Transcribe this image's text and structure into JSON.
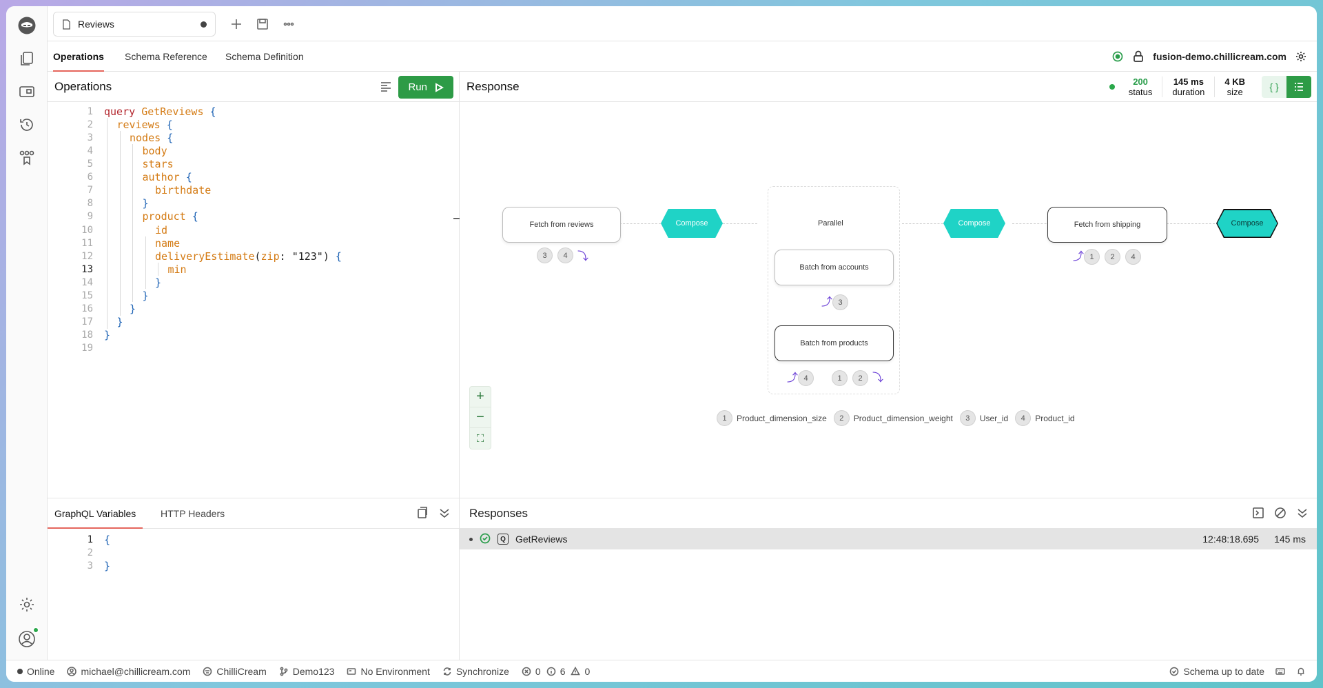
{
  "tab": {
    "title": "Reviews"
  },
  "subnav": {
    "items": [
      "Operations",
      "Schema Reference",
      "Schema Definition"
    ],
    "endpoint": "fusion-demo.chillicream.com"
  },
  "operations": {
    "title": "Operations",
    "run_label": "Run",
    "lines": [
      {
        "n": "1",
        "indent": 0,
        "parts": [
          [
            "kw",
            "query "
          ],
          [
            "nm",
            "GetReviews "
          ],
          [
            "br",
            "{"
          ]
        ]
      },
      {
        "n": "2",
        "indent": 1,
        "parts": [
          [
            "fld",
            "reviews "
          ],
          [
            "br",
            "{"
          ]
        ]
      },
      {
        "n": "3",
        "indent": 2,
        "parts": [
          [
            "fld",
            "nodes "
          ],
          [
            "br",
            "{"
          ]
        ]
      },
      {
        "n": "4",
        "indent": 3,
        "parts": [
          [
            "fld",
            "body"
          ]
        ]
      },
      {
        "n": "5",
        "indent": 3,
        "parts": [
          [
            "fld",
            "stars"
          ]
        ]
      },
      {
        "n": "6",
        "indent": 3,
        "parts": [
          [
            "fld",
            "author "
          ],
          [
            "br",
            "{"
          ]
        ]
      },
      {
        "n": "7",
        "indent": 4,
        "parts": [
          [
            "fld",
            "birthdate"
          ]
        ]
      },
      {
        "n": "8",
        "indent": 3,
        "parts": [
          [
            "br",
            "}"
          ]
        ]
      },
      {
        "n": "9",
        "indent": 3,
        "parts": [
          [
            "fld",
            "product "
          ],
          [
            "br",
            "{"
          ]
        ]
      },
      {
        "n": "10",
        "indent": 4,
        "parts": [
          [
            "fld",
            "id"
          ]
        ]
      },
      {
        "n": "11",
        "indent": 4,
        "parts": [
          [
            "fld",
            "name"
          ]
        ]
      },
      {
        "n": "12",
        "indent": 4,
        "parts": [
          [
            "fld",
            "deliveryEstimate"
          ],
          [
            "pun",
            "("
          ],
          [
            "fld",
            "zip"
          ],
          [
            "pun",
            ": "
          ],
          [
            "str",
            "\"123\""
          ],
          [
            "pun",
            ") "
          ],
          [
            "br",
            "{"
          ]
        ]
      },
      {
        "n": "13",
        "indent": 5,
        "parts": [
          [
            "fld",
            "min"
          ]
        ]
      },
      {
        "n": "14",
        "indent": 4,
        "parts": [
          [
            "br",
            "}"
          ]
        ]
      },
      {
        "n": "15",
        "indent": 3,
        "parts": [
          [
            "br",
            "}"
          ]
        ]
      },
      {
        "n": "16",
        "indent": 2,
        "parts": [
          [
            "br",
            "}"
          ]
        ]
      },
      {
        "n": "17",
        "indent": 1,
        "parts": [
          [
            "br",
            "}"
          ]
        ]
      },
      {
        "n": "18",
        "indent": 0,
        "parts": [
          [
            "br",
            "}"
          ]
        ]
      },
      {
        "n": "19",
        "indent": 0,
        "parts": []
      }
    ],
    "current_line": "13"
  },
  "response": {
    "title": "Response",
    "status": {
      "value": "200",
      "label": "status"
    },
    "duration": {
      "value": "145 ms",
      "label": "duration"
    },
    "size": {
      "value": "4 KB",
      "label": "size"
    },
    "json_label": "{ }"
  },
  "plan": {
    "fetch_reviews": "Fetch from reviews",
    "compose": "Compose",
    "parallel": "Parallel",
    "batch_accounts": "Batch from accounts",
    "batch_products": "Batch from products",
    "fetch_shipping": "Fetch from shipping",
    "chips": {
      "reviews": [
        "3",
        "4"
      ],
      "accounts": [
        "3"
      ],
      "products_in": [
        "4"
      ],
      "products_out": [
        "1",
        "2"
      ],
      "shipping": [
        "1",
        "2",
        "4"
      ]
    },
    "legend": [
      {
        "n": "1",
        "label": "Product_dimension_size"
      },
      {
        "n": "2",
        "label": "Product_dimension_weight"
      },
      {
        "n": "3",
        "label": "User_id"
      },
      {
        "n": "4",
        "label": "Product_id"
      }
    ]
  },
  "variables": {
    "tabs": [
      "GraphQL Variables",
      "HTTP Headers"
    ],
    "lines": [
      {
        "n": "1",
        "text": "{"
      },
      {
        "n": "2",
        "text": ""
      },
      {
        "n": "3",
        "text": "}"
      }
    ]
  },
  "responses": {
    "title": "Responses",
    "row": {
      "name": "GetReviews",
      "badge": "Q",
      "time": "12:48:18.695",
      "duration": "145 ms"
    }
  },
  "statusbar": {
    "online": "Online",
    "user": "michael@chillicream.com",
    "workspace": "ChilliCream",
    "branch": "Demo123",
    "environment": "No Environment",
    "sync": "Synchronize",
    "errors": "0",
    "info": "6",
    "warnings": "0",
    "schema": "Schema up to date"
  }
}
